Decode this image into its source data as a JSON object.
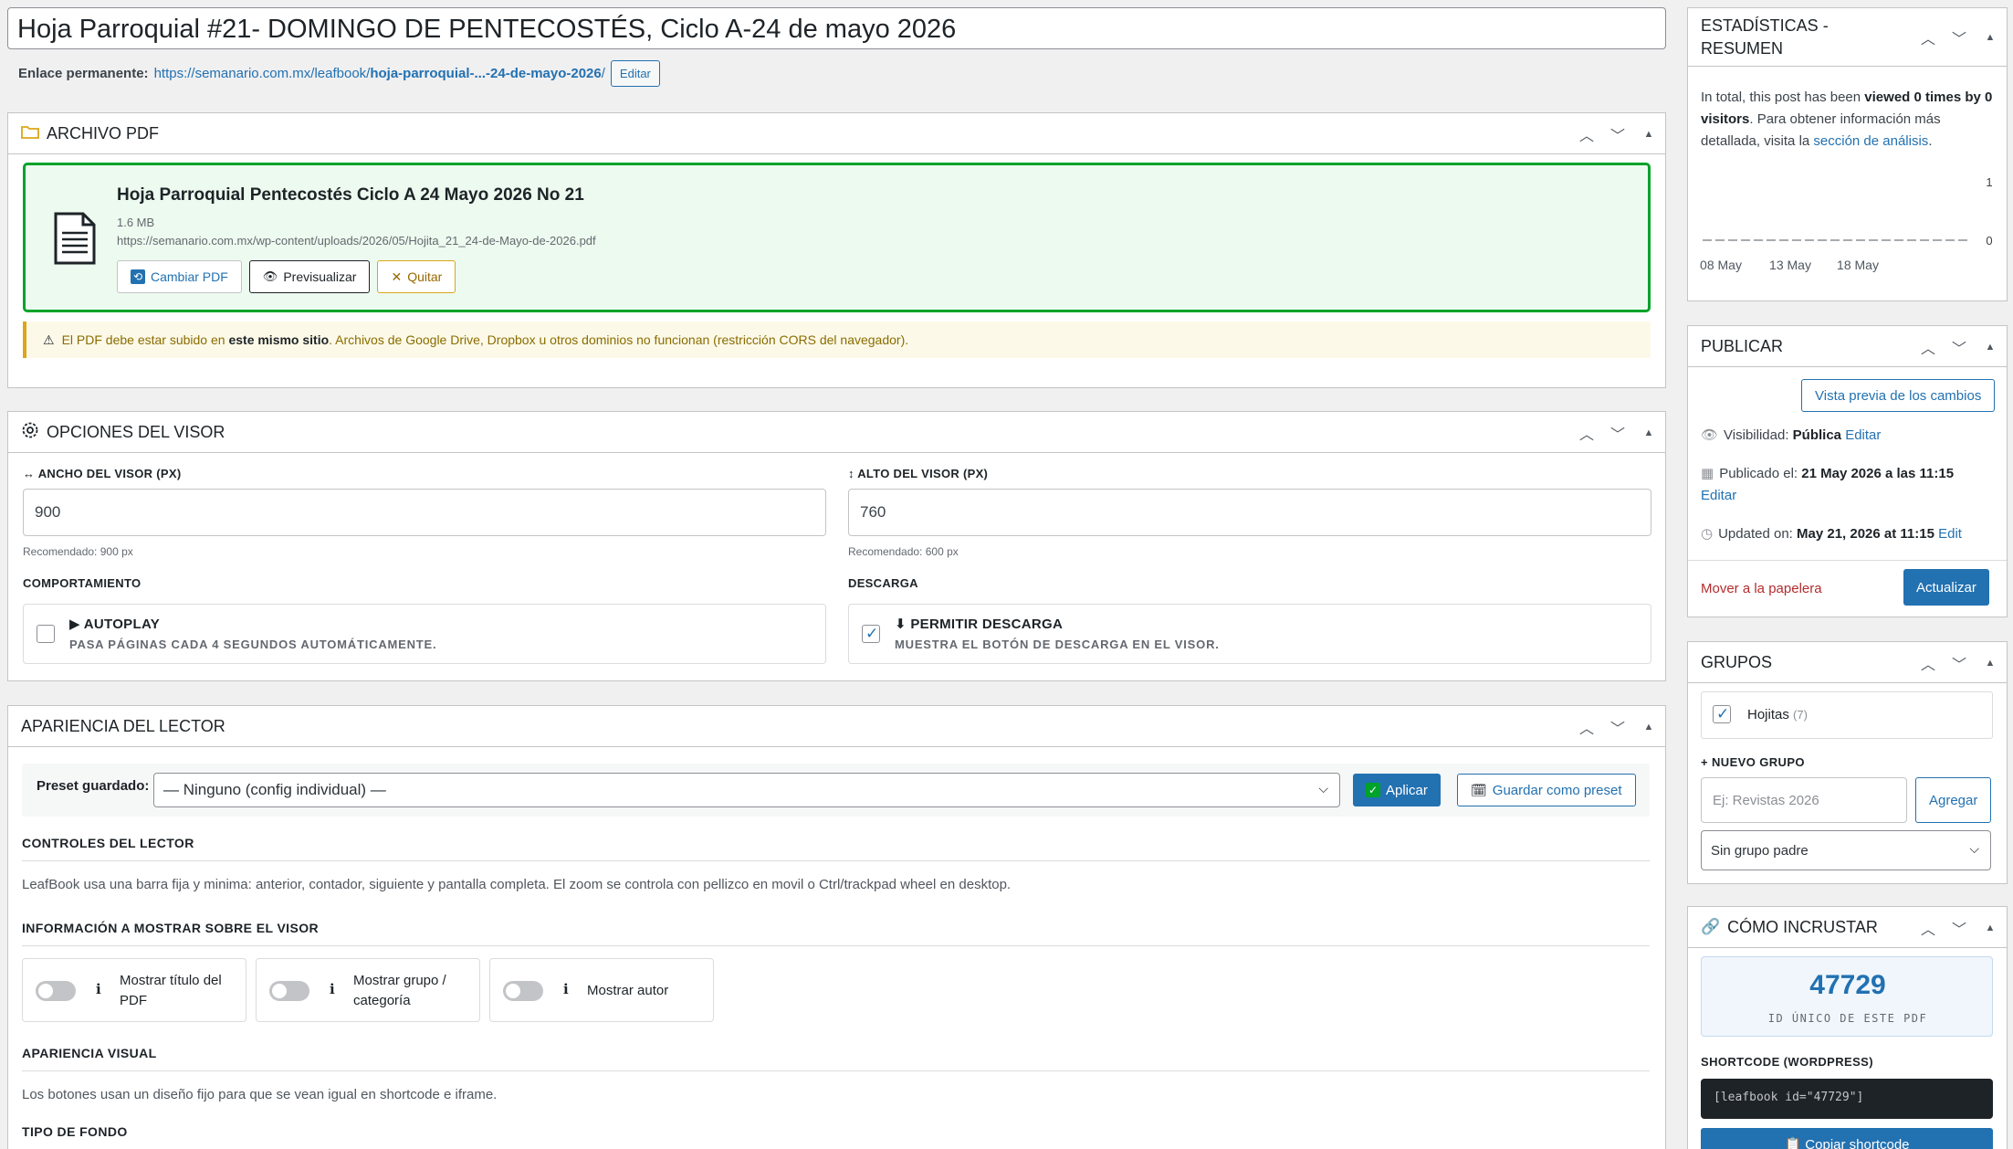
{
  "post": {
    "title": "Hoja Parroquial #21-  DOMINGO DE PENTECOSTÉS, Ciclo A-24 de mayo 2026",
    "permalink_label": "Enlace permanente:",
    "permalink_base": "https://semanario.com.mx/leafbook/",
    "permalink_slug": "hoja-parroquial-...-24-de-mayo-2026",
    "permalink_tail": "/",
    "edit_button": "Editar"
  },
  "pdf_box": {
    "title": "ARCHIVO PDF",
    "file_title": "Hoja Parroquial Pentecostés Ciclo A 24 Mayo 2026 No 21",
    "file_size": "1.6 MB",
    "file_url": "https://semanario.com.mx/wp-content/uploads/2026/05/Hojita_21_24-de-Mayo-de-2026.pdf",
    "change_button": "Cambiar PDF",
    "preview_button": "Previsualizar",
    "remove_button": "Quitar",
    "warning_pre": "El PDF debe estar subido en ",
    "warning_bold": "este mismo sitio",
    "warning_post": ". Archivos de Google Drive, Dropbox u otros dominios no funcionan (restricción CORS del navegador)."
  },
  "viewer_box": {
    "title": "OPCIONES DEL VISOR",
    "width_label": "↔ ANCHO DEL VISOR (PX)",
    "width_value": "900",
    "width_hint": "Recomendado: 900 px",
    "height_label": "↕ ALTO DEL VISOR (PX)",
    "height_value": "760",
    "height_hint": "Recomendado: 600 px",
    "behavior_label": "COMPORTAMIENTO",
    "autoplay_title": "▶ AUTOPLAY",
    "autoplay_sub": "PASA PÁGINAS CADA 4 SEGUNDOS AUTOMÁTICAMENTE.",
    "download_label": "DESCARGA",
    "download_title": "⬇ PERMITIR DESCARGA",
    "download_sub": "MUESTRA EL BOTÓN DE DESCARGA EN EL VISOR."
  },
  "reader_box": {
    "title": "APARIENCIA DEL LECTOR",
    "preset_label": "Preset guardado:",
    "preset_value": "— Ninguno (config individual) —",
    "apply_button": "Aplicar",
    "save_preset_button": "Guardar como preset",
    "controls_title": "CONTROLES DEL LECTOR",
    "controls_text": "LeafBook usa una barra fija y minima: anterior, contador, siguiente y pantalla completa. El zoom se controla con pellizco en movil o Ctrl/trackpad wheel en desktop.",
    "info_title": "INFORMACIÓN A MOSTRAR SOBRE EL VISOR",
    "toggles": [
      {
        "label": "Mostrar título del PDF"
      },
      {
        "label": "Mostrar grupo / categoría"
      },
      {
        "label": "Mostrar autor"
      }
    ],
    "visual_title": "APARIENCIA VISUAL",
    "visual_text": "Los botones usan un diseño fijo para que se vean igual en shortcode e iframe.",
    "bg_title": "TIPO DE FONDO"
  },
  "stats_box": {
    "title_line1": "ESTADÍSTICAS -",
    "title_line2": "RESUMEN",
    "text_pre": "In total, this post has been ",
    "text_bold": "viewed 0 times by 0 visitors",
    "text_mid": ". Para obtener información más detallada, visita la ",
    "text_link": "sección de análisis",
    "text_end": ".",
    "y_max": "1",
    "y_min": "0",
    "x_labels": [
      "08 May",
      "13 May",
      "18 May"
    ]
  },
  "chart_data": {
    "type": "line",
    "categories": [
      "08 May",
      "13 May",
      "18 May"
    ],
    "series": [
      {
        "values": [
          0,
          0,
          0
        ]
      }
    ],
    "ylim": [
      0,
      1
    ]
  },
  "publish_box": {
    "title": "PUBLICAR",
    "preview_button": "Vista previa de los cambios",
    "visibility_label": "Visibilidad: ",
    "visibility_value": "Pública",
    "visibility_edit": "Editar",
    "published_label": "Publicado el: ",
    "published_value": "21 May 2026 a las 11:15",
    "published_edit": "Editar",
    "updated_label": "Updated on: ",
    "updated_value": "May 21, 2026 at 11:15",
    "updated_edit": "Edit",
    "trash_link": "Mover a la papelera",
    "update_button": "Actualizar"
  },
  "groups_box": {
    "title": "GRUPOS",
    "group_name": "Hojitas",
    "group_count": "(7)",
    "new_group_label": "+ NUEVO GRUPO",
    "new_group_placeholder": "Ej: Revistas 2026",
    "add_button": "Agregar",
    "parent_select": "Sin grupo padre"
  },
  "embed_box": {
    "title": "CÓMO INCRUSTAR",
    "pdf_id": "47729",
    "pdf_id_label": "ID ÚNICO DE ESTE PDF",
    "shortcode_label": "SHORTCODE (WORDPRESS)",
    "shortcode": "[leafbook id=\"47729\"]",
    "copy_button": "📋 Copiar shortcode"
  },
  "colors": {
    "accent": "#2271b1",
    "success": "#00a32a",
    "warning": "#dba617",
    "danger": "#b32d2e"
  }
}
